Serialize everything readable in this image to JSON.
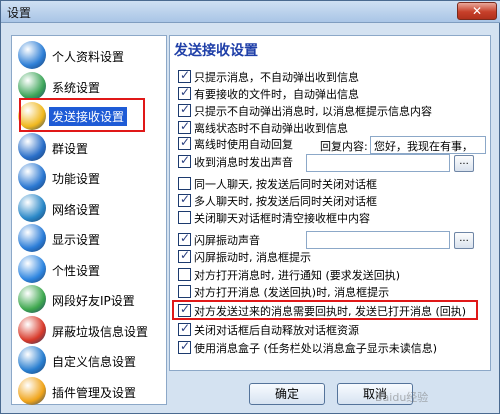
{
  "window": {
    "title": "设置",
    "close_label": "✕"
  },
  "sidebar": {
    "items": [
      {
        "label": "个人资料设置",
        "icon": "profile-icon",
        "color": "#2e7fd6"
      },
      {
        "label": "系统设置",
        "icon": "system-icon",
        "color": "#3ea65a"
      },
      {
        "label": "发送接收设置",
        "icon": "send-receive-icon",
        "color": "#f0b81e",
        "active": true
      },
      {
        "label": "群设置",
        "icon": "group-icon",
        "color": "#2a6fc9"
      },
      {
        "label": "功能设置",
        "icon": "function-icon",
        "color": "#2b78d2"
      },
      {
        "label": "网络设置",
        "icon": "network-icon",
        "color": "#2a88c8"
      },
      {
        "label": "显示设置",
        "icon": "display-icon",
        "color": "#2b7dd8"
      },
      {
        "label": "个性设置",
        "icon": "personal-icon",
        "color": "#2f86e0"
      },
      {
        "label": "网段好友IP设置",
        "icon": "ip-icon",
        "color": "#3fa84f"
      },
      {
        "label": "屏蔽垃圾信息设置",
        "icon": "block-spam-icon",
        "color": "#d83a2a"
      },
      {
        "label": "自定义信息设置",
        "icon": "custom-info-icon",
        "color": "#2a7fd0"
      },
      {
        "label": "插件管理及设置",
        "icon": "plugin-icon",
        "color": "#f0a41a"
      }
    ]
  },
  "panel": {
    "title": "发送接收设置",
    "reply_caption": "回复内容:",
    "reply_value": "您好，我现在有事，",
    "options": [
      {
        "label": "只提示消息，不自动弹出收到信息",
        "checked": true
      },
      {
        "label": "有要接收的文件时，自动弹出信息",
        "checked": true
      },
      {
        "label": "只提示不自动弹出消息时, 以消息框提示信息内容",
        "checked": true
      },
      {
        "label": "离线状态时不自动弹出收到信息",
        "checked": true
      },
      {
        "label": "离线时使用自动回复",
        "checked": true
      },
      {
        "label": "收到消息时发出声音",
        "checked": true
      },
      {
        "label": "同一人聊天, 按发送后同时关闭对话框",
        "checked": false
      },
      {
        "label": "多人聊天时, 按发送后同时关闭对话框",
        "checked": true
      },
      {
        "label": "关闭聊天对话框时清空接收框中内容",
        "checked": false
      },
      {
        "label": "闪屏振动声音",
        "checked": true
      },
      {
        "label": "闪屏振动时, 消息框提示",
        "checked": true
      },
      {
        "label": "对方打开消息时, 进行通知 (要求发送回执)",
        "checked": false
      },
      {
        "label": "对方打开消息 (发送回执)时, 消息框提示",
        "checked": false
      },
      {
        "label": "对方发送过来的消息需要回执时, 发送已打开消息 (回执)",
        "checked": true
      },
      {
        "label": "关闭对话框后自动释放对话框资源",
        "checked": true
      },
      {
        "label": "使用消息盒子 (任务栏处以消息盒子显示未读信息)",
        "checked": true
      }
    ],
    "browse_label": "..."
  },
  "buttons": {
    "ok": "确定",
    "cancel": "取消"
  },
  "watermark": "Baidu经验"
}
